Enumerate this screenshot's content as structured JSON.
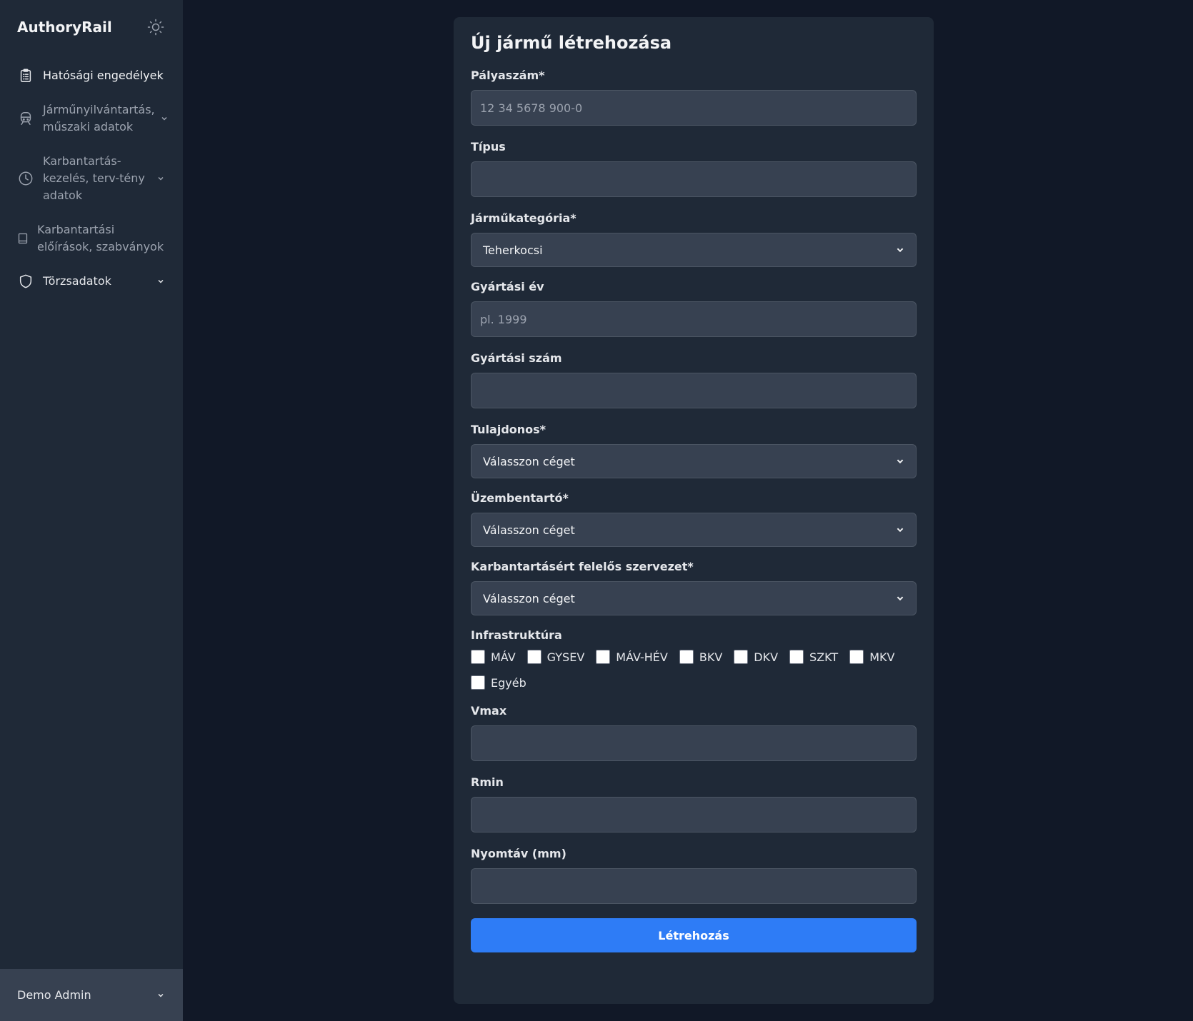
{
  "sidebar": {
    "brand": "AuthoryRail",
    "theme_icon": "sun-icon",
    "items": [
      {
        "label": "Hatósági engedélyek",
        "icon": "clipboard-icon",
        "has_children": false
      },
      {
        "label": "Járműnyilvántartás, műszaki adatok",
        "icon": "train-icon",
        "has_children": true
      },
      {
        "label": "Karbantartás-kezelés, terv-tény adatok",
        "icon": "clock-icon",
        "has_children": true
      },
      {
        "label": "Karbantartási előírások, szabványok",
        "icon": "book-icon",
        "has_children": false
      },
      {
        "label": "Törzsadatok",
        "icon": "shield-icon",
        "has_children": true
      }
    ],
    "user": "Demo Admin"
  },
  "form": {
    "title": "Új jármű létrehozása",
    "fields": {
      "palyaszam": {
        "label": "Pályaszám*",
        "placeholder": "12 34 5678 900-0",
        "value": ""
      },
      "tipus": {
        "label": "Típus",
        "placeholder": "",
        "value": ""
      },
      "kategoria": {
        "label": "Járműkategória*",
        "selected": "Teherkocsi"
      },
      "gyartasi_ev": {
        "label": "Gyártási év",
        "placeholder": "pl. 1999",
        "value": ""
      },
      "gyartasi_szam": {
        "label": "Gyártási szám",
        "placeholder": "",
        "value": ""
      },
      "tulajdonos": {
        "label": "Tulajdonos*",
        "selected": "Válasszon céget"
      },
      "uzembentarto": {
        "label": "Üzembentartó*",
        "selected": "Válasszon céget"
      },
      "karbantarto": {
        "label": "Karbantartásért felelős szervezet*",
        "selected": "Válasszon céget"
      },
      "infrastruktura": {
        "label": "Infrastruktúra",
        "options": [
          {
            "label": "MÁV",
            "checked": false
          },
          {
            "label": "GYSEV",
            "checked": false
          },
          {
            "label": "MÁV-HÉV",
            "checked": false
          },
          {
            "label": "BKV",
            "checked": false
          },
          {
            "label": "DKV",
            "checked": false
          },
          {
            "label": "SZKT",
            "checked": false
          },
          {
            "label": "MKV",
            "checked": false
          },
          {
            "label": "Egyéb",
            "checked": false
          }
        ]
      },
      "vmax": {
        "label": "Vmax",
        "placeholder": "",
        "value": ""
      },
      "rmin": {
        "label": "Rmin",
        "placeholder": "",
        "value": ""
      },
      "nyomtav": {
        "label": "Nyomtáv (mm)",
        "placeholder": "",
        "value": ""
      }
    },
    "submit_label": "Létrehozás"
  },
  "colors": {
    "background": "#111827",
    "panel": "#1f2937",
    "input": "#374151",
    "accent": "#2e7cf6"
  }
}
